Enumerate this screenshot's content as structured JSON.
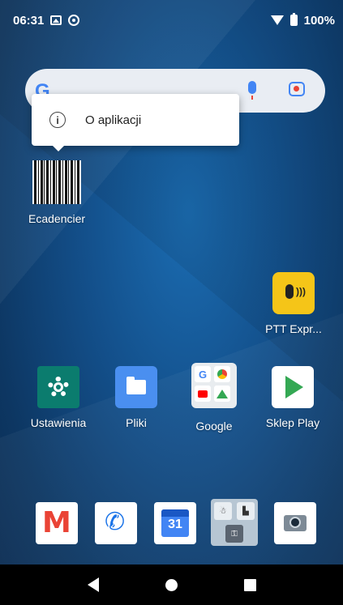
{
  "status_bar": {
    "time": "06:31",
    "battery": "100%"
  },
  "popup": {
    "label": "O aplikacji",
    "icon": "info-icon"
  },
  "apps": {
    "ecadencier": "Ecadencier",
    "ptt": "PTT Expr...",
    "settings": "Ustawienia",
    "files": "Pliki",
    "google": "Google",
    "play": "Sklep Play"
  },
  "dock": {
    "calendar_day": "31",
    "items": [
      "gmail-icon",
      "phone-icon",
      "calendar-icon",
      "folder-icon",
      "camera-icon"
    ]
  },
  "nav_bar": {
    "items": [
      "back-icon",
      "home-icon",
      "recents-icon"
    ]
  },
  "colors": {
    "wallpaper": "#134f8a",
    "ptt_yellow": "#f5c518",
    "settings_teal": "#0b7c6e",
    "files_blue": "#4a8ff0"
  }
}
